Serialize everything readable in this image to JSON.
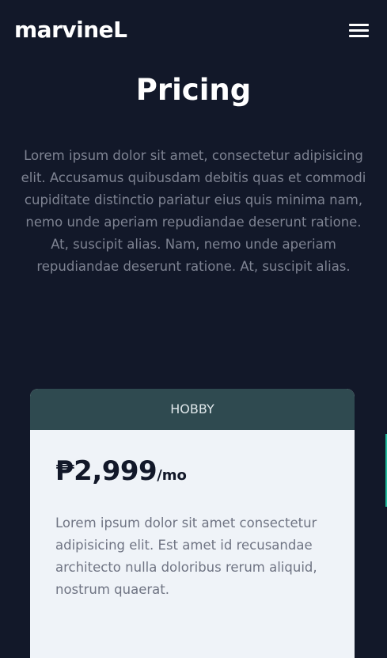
{
  "navbar": {
    "brand": "marvineL",
    "menu_icon": "hamburger-menu-icon"
  },
  "hero": {
    "title": "Pricing",
    "description": "Lorem ipsum dolor sit amet, consectetur adipisicing elit. Accusamus quibusdam debitis quas et commodi cupiditate distinctio pariatur eius quis minima nam, nemo unde aperiam repudiandae deserunt ratione. At, suscipit alias. Nam, nemo unde aperiam repudiandae deserunt ratione. At, suscipit alias."
  },
  "plans": [
    {
      "name": "HOBBY",
      "price": "₱2,999",
      "period": "/mo",
      "description": "Lorem ipsum dolor sit amet consectetur adipisicing elit. Est amet id recusandae architecto nulla doloribus rerum aliquid, nostrum quaerat."
    }
  ],
  "colors": {
    "background": "#121829",
    "card_header": "#2f4a50",
    "card_body": "#eff3f8",
    "accent": "#1fb79a"
  }
}
